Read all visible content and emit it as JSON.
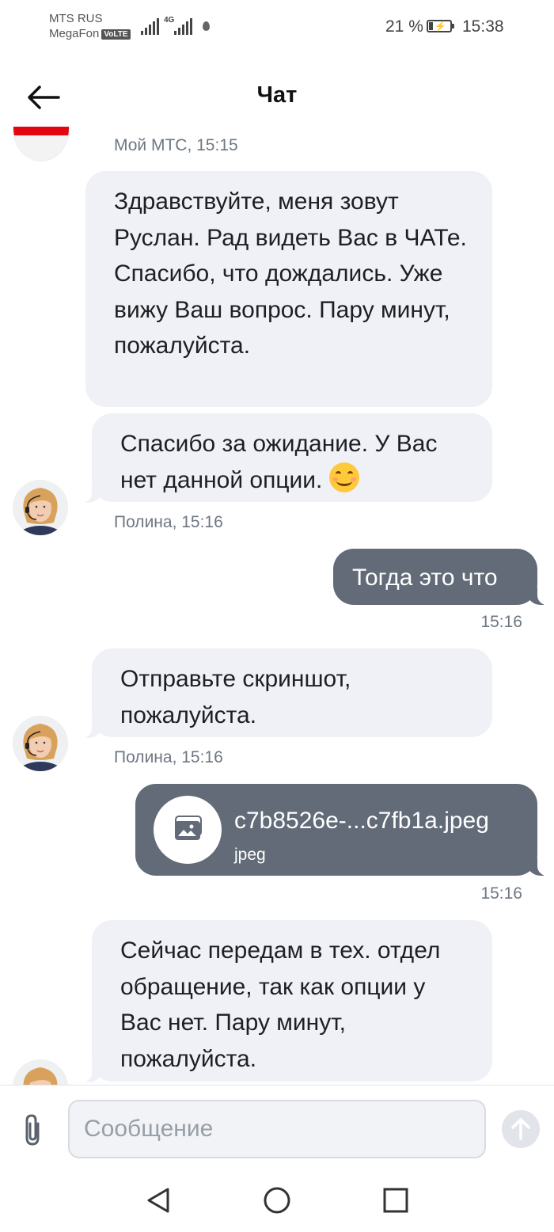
{
  "status_bar": {
    "carrier_1": "MTS RUS",
    "carrier_2": "MegaFon",
    "volte": "VoLTE",
    "network": "4G",
    "battery_percent": "21 %",
    "battery_level": 0.21,
    "time": "15:38"
  },
  "header": {
    "title": "Чат",
    "back_icon": "arrow-left-icon"
  },
  "messages": [
    {
      "sender_meta": "Мой МТС, 15:15"
    },
    {
      "text": "Здравствуйте, меня зовут Руслан. Рад видеть Вас в ЧАТе. Спасибо, что дождались. Уже вижу Ваш вопрос. Пару минут, пожалуйста."
    },
    {
      "text": "Спасибо за ожидание. У Вас нет данной опции.",
      "emoji": "smiling-face-icon",
      "sender_meta": "Полина, 15:16"
    },
    {
      "text": "Тогда это что",
      "time": "15:16"
    },
    {
      "text": "Отправьте скриншот, пожалуйста.",
      "sender_meta": "Полина, 15:16"
    },
    {
      "file_name": "c7b8526e-...c7fb1a.jpeg",
      "file_type": "jpeg",
      "time": "15:16"
    },
    {
      "text": "Сейчас передам в тех. отдел обращение, так как опции у Вас нет. Пару минут, пожалуйста."
    }
  ],
  "composer": {
    "placeholder": "Сообщение",
    "attach_icon": "paperclip-icon",
    "send_icon": "arrow-up-icon"
  },
  "navigation": {
    "back": "triangle-back-icon",
    "home": "circle-home-icon",
    "recents": "square-recents-icon"
  },
  "colors": {
    "incoming_bubble": "#f0f1f6",
    "outgoing_bubble": "#626b77",
    "meta_text": "#6e7782",
    "mts_red": "#e30611"
  }
}
